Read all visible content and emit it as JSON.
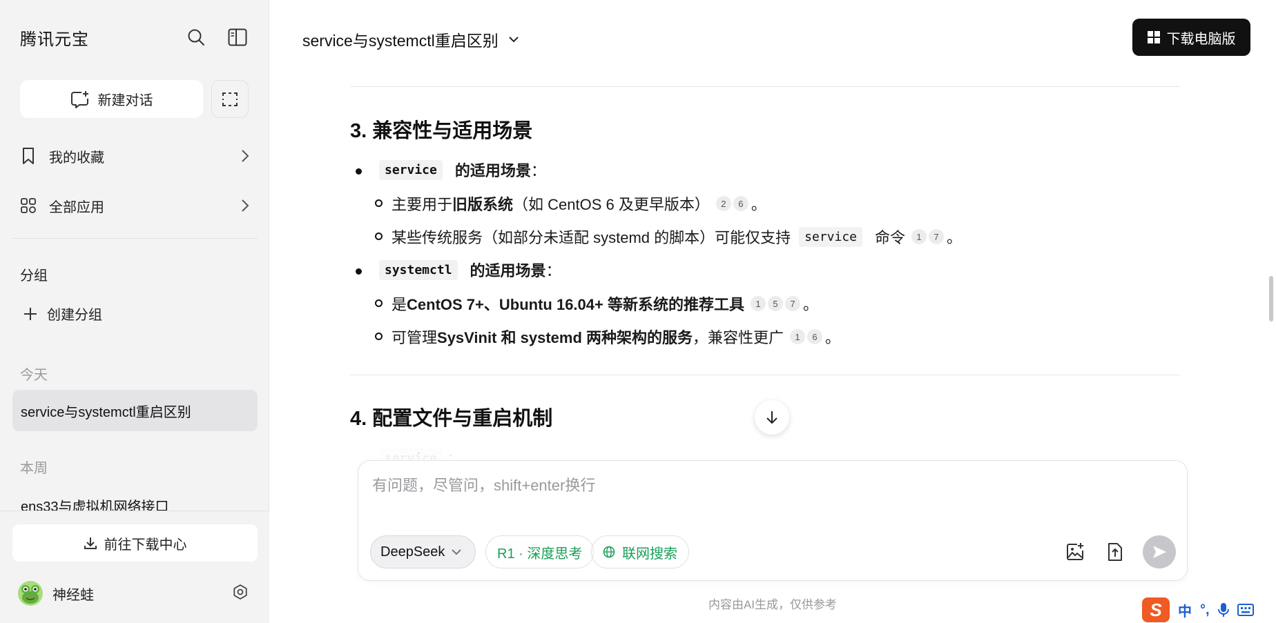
{
  "sidebar": {
    "brand": "腾讯元宝",
    "new_chat": "新建对话",
    "nav": [
      {
        "label": "我的收藏"
      },
      {
        "label": "全部应用"
      }
    ],
    "group_title": "分组",
    "create_group": "创建分组",
    "today_label": "今天",
    "today_items": [
      "service与systemctl重启区别"
    ],
    "week_label": "本周",
    "week_items": [
      "ens33与虚拟机网络接口"
    ],
    "download_center": "前往下载中心",
    "user": {
      "name": "神经蛙"
    }
  },
  "header": {
    "title": "service与systemctl重启区别",
    "download_pc": "下载电脑版"
  },
  "content": {
    "section3": {
      "title": "3. 兼容性与适用场景",
      "items": [
        {
          "code": "service",
          "label": "的适用场景",
          "colon": "：",
          "subitems": [
            {
              "pre": "主要用于 ",
              "bold": "旧版系统",
              "post": "（如 CentOS 6 及更早版本）",
              "cites": [
                "2",
                "6"
              ],
              "end": "。"
            },
            {
              "pre": "某些传统服务（如部分未适配 systemd 的脚本）可能仅支持 ",
              "code": "service",
              "post": " 命令",
              "cites": [
                "1",
                "7"
              ],
              "end": "。"
            }
          ]
        },
        {
          "code": "systemctl",
          "label": "的适用场景",
          "colon": "：",
          "subitems": [
            {
              "pre": "是 ",
              "bold": "CentOS 7+、Ubuntu 16.04+ 等新系统的推荐工具",
              "cites": [
                "1",
                "5",
                "7"
              ],
              "end": "。"
            },
            {
              "pre": "可管理 ",
              "bold": "SysVinit 和 systemd 两种架构的服务",
              "post": "，兼容性更广",
              "cites": [
                "1",
                "6"
              ],
              "end": "。"
            }
          ]
        }
      ]
    },
    "section4": {
      "title": "4. 配置文件与重启机制",
      "partial_code": "service",
      "partial_colon": "："
    }
  },
  "input": {
    "placeholder": "有问题，尽管问，shift+enter换行",
    "model": "DeepSeek",
    "think": "R1 · 深度思考",
    "web": "联网搜索"
  },
  "disclaimer": "内容由AI生成，仅供参考",
  "ime": {
    "text": "中",
    "punct": "°,"
  },
  "colors": {
    "accent_green": "#18a058",
    "dark_button": "#111111"
  }
}
